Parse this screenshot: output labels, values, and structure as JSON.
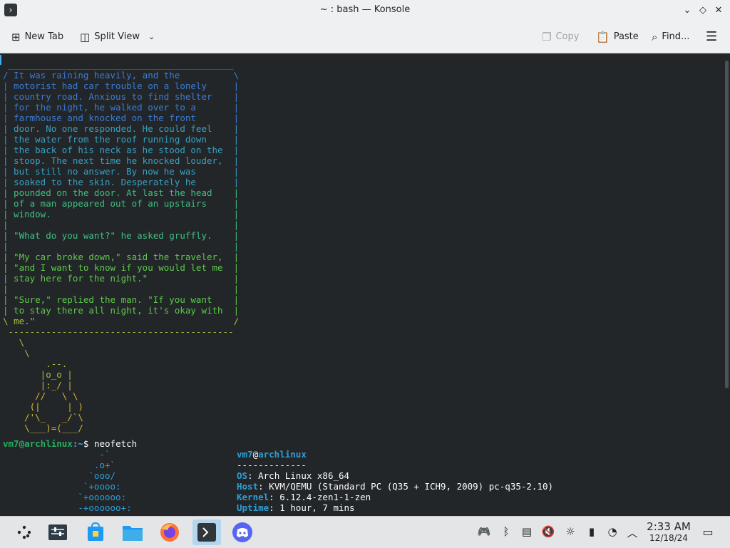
{
  "window": {
    "title": "~ : bash — Konsole"
  },
  "toolbar": {
    "new_tab": "New Tab",
    "split_view": "Split View",
    "copy": "Copy",
    "paste": "Paste",
    "find": "Find..."
  },
  "terminal": {
    "cowsay_lines": [
      " __________________________________________",
      "/ It was raining heavily, and the          \\",
      "| motorist had car trouble on a lonely     |",
      "| country road. Anxious to find shelter    |",
      "| for the night, he walked over to a       |",
      "| farmhouse and knocked on the front       |",
      "| door. No one responded. He could feel    |",
      "| the water from the roof running down     |",
      "| the back of his neck as he stood on the  |",
      "| stoop. The next time he knocked louder,  |",
      "| but still no answer. By now he was       |",
      "| soaked to the skin. Desperately he       |",
      "| pounded on the door. At last the head    |",
      "| of a man appeared out of an upstairs     |",
      "| window.                                  |",
      "|                                          |",
      "| \"What do you want?\" he asked gruffly.    |",
      "|                                          |",
      "| \"My car broke down,\" said the traveler,  |",
      "| \"and I want to know if you would let me  |",
      "| stay here for the night.\"                |",
      "|                                          |",
      "| \"Sure,\" replied the man. \"If you want    |",
      "| to stay there all night, it's okay with  |",
      "\\ me.\"                                     /",
      " ------------------------------------------",
      "   \\",
      "    \\",
      "        .--.",
      "       |o_o |",
      "       |:_/ |",
      "      //   \\ \\",
      "     (|     | )",
      "    /'\\_   _/`\\",
      "    \\___)=(___/"
    ],
    "prompt_user": "vm7@archlinux",
    "prompt_path": ":~",
    "prompt_symbol": "$",
    "command": "neofetch",
    "logo_lines": [
      "                  -`",
      "                 .o+`",
      "                `ooo/",
      "               `+oooo:",
      "              `+oooooo:",
      "              -+oooooo+:"
    ],
    "info": {
      "user": "vm7",
      "at": "@",
      "host": "archlinux",
      "separator": "-------------",
      "rows": [
        {
          "key": "OS",
          "value": "Arch Linux x86_64"
        },
        {
          "key": "Host",
          "value": "KVM/QEMU (Standard PC (Q35 + ICH9, 2009) pc-q35-2.10)"
        },
        {
          "key": "Kernel",
          "value": "6.12.4-zen1-1-zen"
        },
        {
          "key": "Uptime",
          "value": "1 hour, 7 mins"
        }
      ]
    }
  },
  "taskbar": {
    "apps": [
      "application-launcher-icon",
      "system-settings-icon",
      "discover-store-icon",
      "file-manager-icon",
      "firefox-icon",
      "konsole-icon",
      "discord-icon"
    ],
    "tray_icons": [
      "gamepad-icon",
      "bluetooth-icon",
      "clipboard-icon",
      "volume-muted-icon",
      "brightness-icon",
      "battery-icon",
      "updates-icon",
      "expand-tray-icon"
    ]
  },
  "clock": {
    "time": "2:33 AM",
    "date": "12/18/24"
  },
  "colors": {
    "cowsay_gradient": [
      "#3a7bd5",
      "#36a0c0",
      "#3fbf7f",
      "#5dc84a",
      "#9fc63a",
      "#d2b830"
    ],
    "prompt_green": "#27ae60",
    "prompt_blue": "#3daee9",
    "arch_cyan": "#2a9fd6",
    "fg": "#fcfcfc"
  }
}
